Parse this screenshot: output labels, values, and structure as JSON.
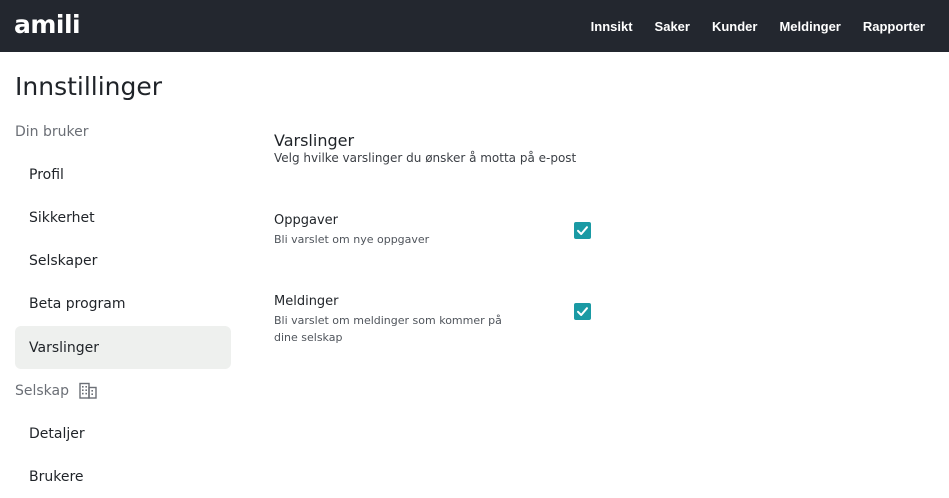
{
  "app": {
    "logo": "amili"
  },
  "nav": {
    "items": [
      "Innsikt",
      "Saker",
      "Kunder",
      "Meldinger",
      "Rapporter"
    ]
  },
  "page": {
    "title": "Innstillinger"
  },
  "sidebar": {
    "group_user": "Din bruker",
    "user_items": [
      "Profil",
      "Sikkerhet",
      "Selskaper",
      "Beta program",
      "Varslinger"
    ],
    "active_item": "Varslinger",
    "group_company": "Selskap",
    "group_company_icon": "building-icon",
    "company_items": [
      "Detaljer",
      "Brukere"
    ]
  },
  "main": {
    "title": "Varslinger",
    "subtitle": "Velg hvilke varslinger du ønsker å motta på e-post",
    "options": [
      {
        "title": "Oppgaver",
        "description": "Bli varslet om nye oppgaver",
        "checked": true
      },
      {
        "title": "Meldinger",
        "description": "Bli varslet om meldinger som kommer på dine selskap",
        "checked": true
      }
    ]
  },
  "colors": {
    "topbar": "#23272f",
    "accent": "#1a9aa4",
    "active_bg": "#eef0ee"
  }
}
